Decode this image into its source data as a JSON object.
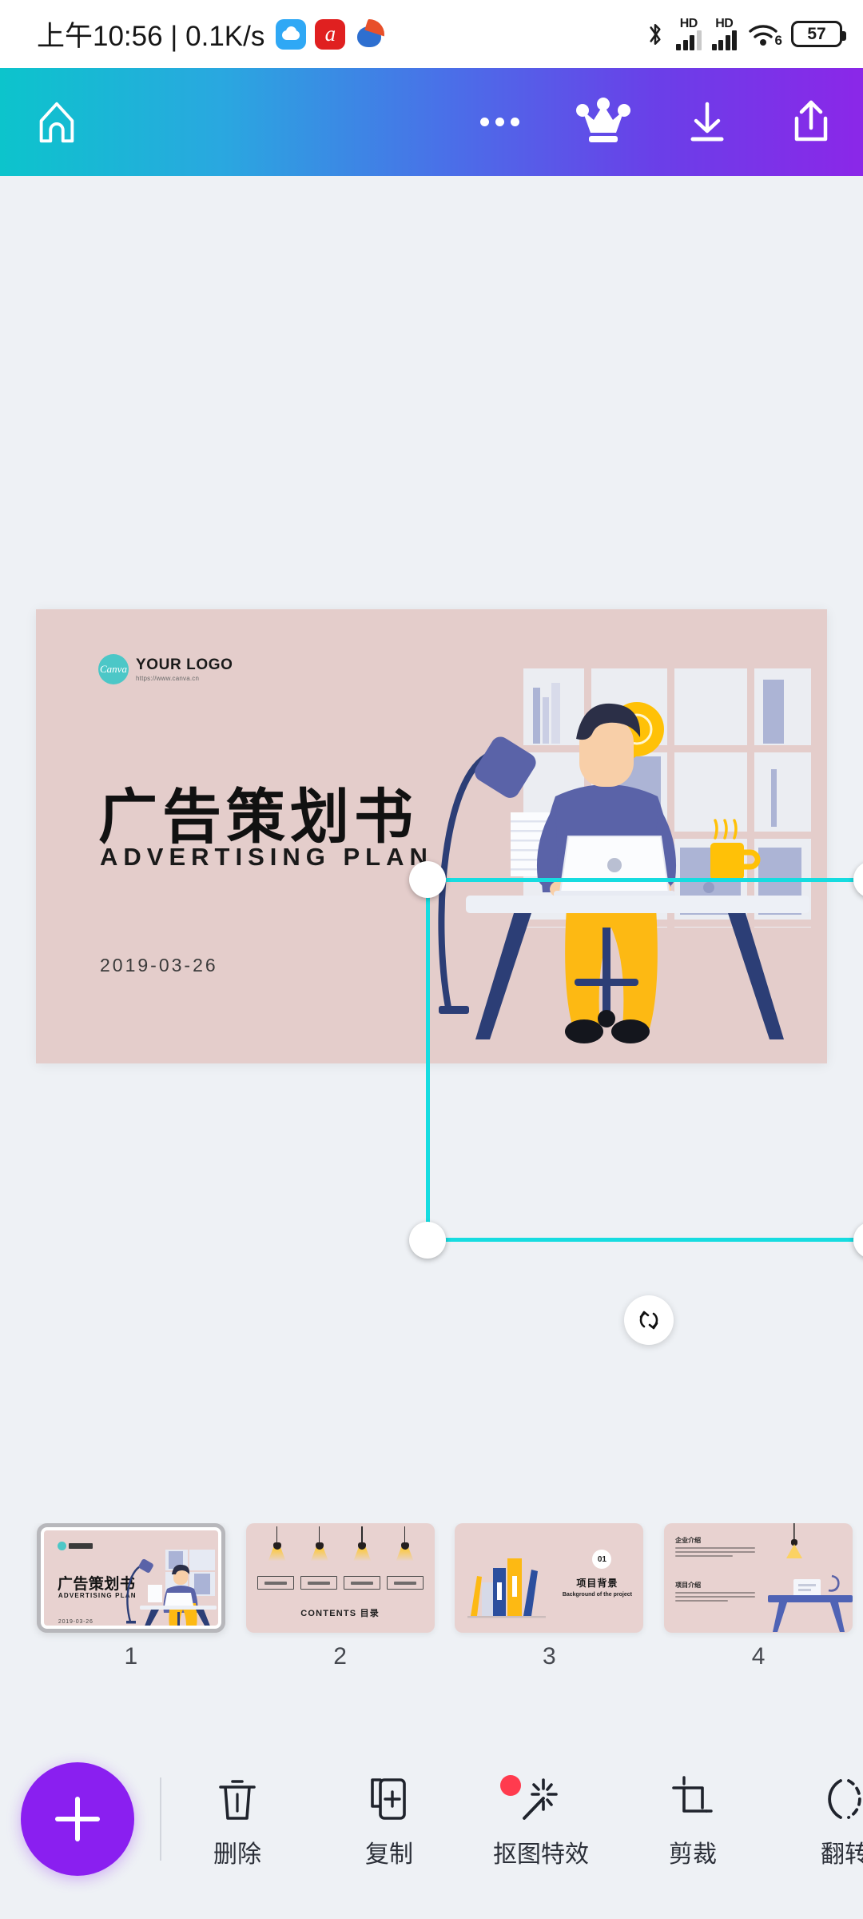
{
  "statusbar": {
    "time_text": "上午10:56 | 0.1K/s",
    "app_icons": [
      "cloud-icon",
      "alipay-icon",
      "baidu-icon"
    ],
    "bluetooth": "bluetooth-icon",
    "signal_1_label": "HD",
    "signal_2_label": "HD",
    "wifi_label": "6",
    "battery_level": "57"
  },
  "topbar": {
    "home": "home-icon",
    "more": "more-options-icon",
    "crown": "crown-icon",
    "download": "download-icon",
    "share": "share-icon",
    "gradient_start": "#0cc4cc",
    "gradient_end": "#8b27e8"
  },
  "canvas": {
    "background": "#eef1f5",
    "slide": {
      "background": "#e4cdcb",
      "logo_main": "YOUR LOGO",
      "logo_sub": "https://www.canva.cn",
      "title": "广告策划书",
      "subtitle": "ADVERTISING PLAN",
      "date": "2019-03-26"
    },
    "selection": {
      "color": "#16dce0",
      "handle_count": 4
    },
    "rotate_button": "rotate-icon"
  },
  "thumbnails": [
    {
      "number": "1",
      "active": true,
      "title": "广告策划书",
      "subtitle": "ADVERTISING PLAN",
      "date": "2019-03-26"
    },
    {
      "number": "2",
      "active": false,
      "contents_label": "CONTENTS  目录",
      "box_count": 4,
      "lamp_count": 4
    },
    {
      "number": "3",
      "active": false,
      "badge": "01",
      "title": "项目背景",
      "subtitle": "Background of the project"
    },
    {
      "number": "4",
      "active": false,
      "heading_1": "企业介绍",
      "heading_2": "项目介绍"
    }
  ],
  "bottombar": {
    "add_button": "add-icon",
    "items": [
      {
        "label": "删除",
        "icon": "trash-icon",
        "badge": false
      },
      {
        "label": "复制",
        "icon": "copy-icon",
        "badge": false
      },
      {
        "label": "抠图特效",
        "icon": "magic-wand-icon",
        "badge": true
      },
      {
        "label": "剪裁",
        "icon": "crop-icon",
        "badge": false
      },
      {
        "label": "翻转",
        "icon": "flip-icon",
        "badge": false
      }
    ],
    "badge_color": "#ff3b4e",
    "fab_color": "#8a1ff0"
  }
}
